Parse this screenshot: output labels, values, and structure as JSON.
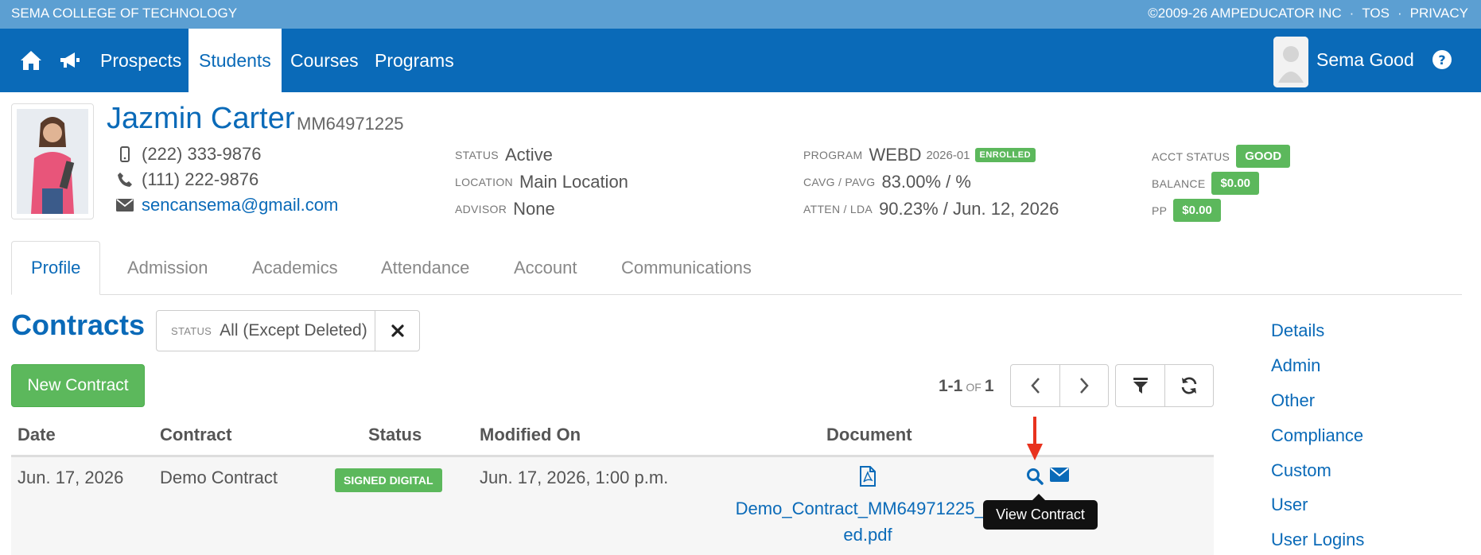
{
  "topbar": {
    "org": "SEMA COLLEGE OF TECHNOLOGY",
    "copyright": "©2009-26 AMPEDUCATOR INC",
    "tos": "TOS",
    "privacy": "PRIVACY",
    "separator": "·"
  },
  "nav": {
    "icons": [
      "home-icon",
      "megaphone-icon"
    ],
    "items": [
      {
        "label": "Prospects",
        "active": false
      },
      {
        "label": "Students",
        "active": true
      },
      {
        "label": "Courses",
        "active": false
      },
      {
        "label": "Programs",
        "active": false
      }
    ],
    "user_name": "Sema Good",
    "help_icon": "question-circle-icon",
    "color": "#0a6ab8"
  },
  "student": {
    "name": "Jazmin Carter",
    "id": "MM64971225",
    "mobile": "(222) 333-9876",
    "phone": "(111) 222-9876",
    "email": "sencansema@gmail.com"
  },
  "info": {
    "status_label": "STATUS",
    "status": "Active",
    "location_label": "LOCATION",
    "location": "Main Location",
    "advisor_label": "ADVISOR",
    "advisor": "None",
    "program_label": "PROGRAM",
    "program": "WEBD",
    "program_term": "2026-01",
    "program_badge": "ENROLLED",
    "cavg_label": "CAVG / PAVG",
    "cavg": "83.00% / %",
    "atten_label": "ATTEN / LDA",
    "atten": "90.23% / Jun. 12, 2026",
    "acct_label": "ACCT STATUS",
    "acct": "GOOD",
    "balance_label": "BALANCE",
    "balance": "$0.00",
    "pp_label": "PP",
    "pp": "$0.00",
    "badge_color": "#5cb85c"
  },
  "tabs": [
    {
      "label": "Profile",
      "active": true
    },
    {
      "label": "Admission",
      "active": false
    },
    {
      "label": "Academics",
      "active": false
    },
    {
      "label": "Attendance",
      "active": false
    },
    {
      "label": "Account",
      "active": false
    },
    {
      "label": "Communications",
      "active": false
    }
  ],
  "contracts": {
    "title": "Contracts",
    "filter_label": "STATUS",
    "filter_value": "All (Except Deleted)",
    "new_button": "New Contract",
    "pager_range": "1-1",
    "pager_of": "OF",
    "pager_total": "1",
    "columns": [
      "Date",
      "Contract",
      "Status",
      "Modified On",
      "Document"
    ],
    "row": {
      "date": "Jun. 17, 2026",
      "contract": "Demo Contract",
      "status": "SIGNED DIGITAL",
      "modified": "Jun. 17, 2026, 1:00 p.m.",
      "doc_line1": "Demo_Contract_MM64971225_Si",
      "doc_line2": "ed.pdf"
    },
    "tooltip": "View Contract"
  },
  "side_links": [
    "Details",
    "Admin",
    "Other",
    "Compliance",
    "Custom",
    "User",
    "User Logins"
  ]
}
